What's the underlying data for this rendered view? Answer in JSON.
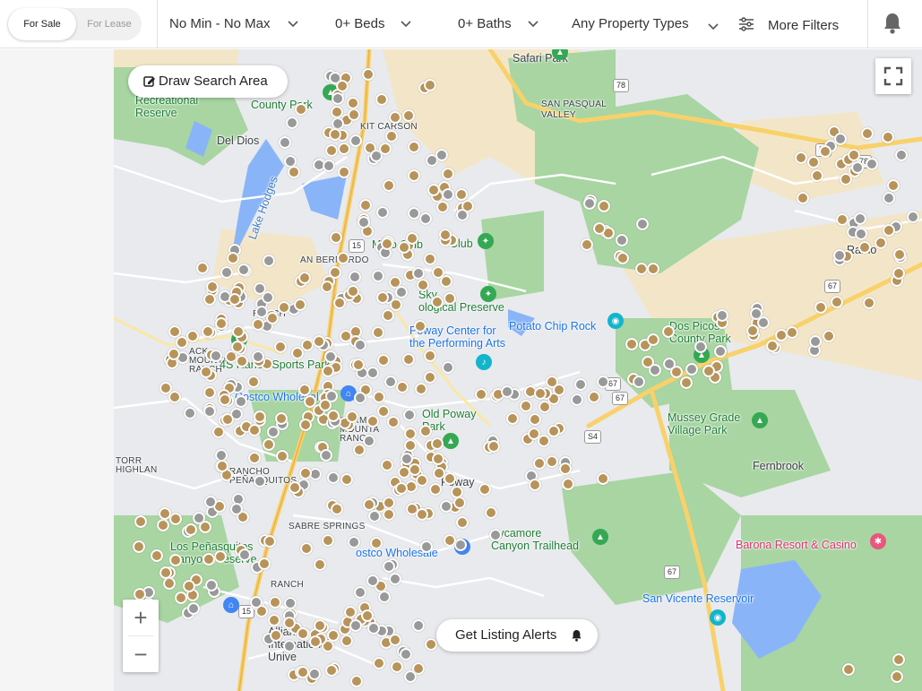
{
  "listing_type": {
    "for_sale": "For Sale",
    "for_lease": "For Lease",
    "selected": "For Sale"
  },
  "filters": {
    "price": "No Min - No Max",
    "beds": "0+ Beds",
    "baths": "0+ Baths",
    "property_types": "Any Property Types",
    "more_filters": "More Filters"
  },
  "map": {
    "draw_search_area": "Draw Search Area",
    "get_listing_alerts": "Get Listing Alerts",
    "zoom_in": "+",
    "zoom_out": "−",
    "labels": {
      "safari_park": "Safari Park",
      "san_pasqual_valley": "SAN PASQUAL\nVALLEY",
      "recreational_reserve": "Recreational\nReserve",
      "county_park": "County Park",
      "kit_carson": "KIT CARSON",
      "del_dios": "Del Dios",
      "lake_hodges": "Lake Hodges",
      "club": "Club",
      "ramona": "Ramo",
      "ranch": "RANCH",
      "black_mountain_ranch": "ACK\nMOUNTAIN\nRANCH",
      "four_s_ranch": "4S Ranch Sports Park",
      "poway_center": "Poway Center for\nthe Performing Arts",
      "potato_chip_rock": "Potato Chip Rock",
      "dos_picos": "Dos Picos\nCounty Park",
      "costco_wholesale_1": "Costco Wholesale",
      "carmel_mountain_ranch": "CARM\nMOUNTA\nRANC",
      "old_poway_park": "Old Poway\nPark",
      "mussey_grade": "Mussey Grade\nVillage Park",
      "fernbrook": "Fernbrook",
      "torrey_highlands": "TORR\nHIGHLAN",
      "rancho_penasquitos": "RANCHO\nPEÑASQUITOS",
      "poway": "Poway",
      "sabre_springs": "SABRE SPRINGS",
      "penasquitos_preserve": "Los Peñasquitos\nCanyon Preserve",
      "costco_wholesale_2": "ostco Wholesale",
      "sycamore_canyon": "Sycamore\nCanyon Trailhead",
      "barona": "Barona Resort & Casino",
      "san_vicente": "San Vicente Reservoir",
      "rancho_bernardo": "RANCH",
      "alliant": "Alliant\nInternational\nUnive",
      "sky_preserve": "Sky\nological Preserve",
      "s_club": "Ma    o    Club",
      "bernardo": "AN BERNARDO"
    },
    "route_shields": [
      "78",
      "78",
      "78",
      "67",
      "67",
      "67",
      "S4",
      "67",
      "15",
      "15"
    ]
  },
  "colors": {
    "pin_gold": "#b8945a",
    "pin_grey": "#999999",
    "park_green": "#a8d5a2",
    "water_blue": "#8ab4f8",
    "highway_yellow": "#f8d16a"
  }
}
